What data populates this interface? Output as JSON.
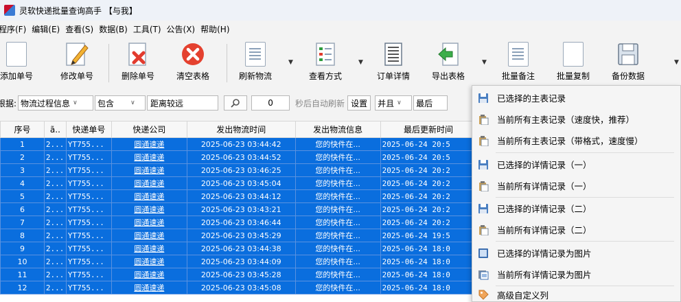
{
  "window": {
    "title": "灵软快递批量查询高手 【与我】"
  },
  "menu": [
    "程序(F)",
    "编辑(E)",
    "查看(S)",
    "数据(B)",
    "工具(T)",
    "公告(X)",
    "帮助(H)"
  ],
  "toolbar": {
    "add": "添加单号",
    "edit": "修改单号",
    "delete": "删除单号",
    "clear": "清空表格",
    "refresh": "刷新物流",
    "view": "查看方式",
    "detail": "订单详情",
    "export": "导出表格",
    "note": "批量备注",
    "copy": "批量复制",
    "backup": "备份数据"
  },
  "filter": {
    "label": "根据:",
    "field": "物流过程信息",
    "op": "包含",
    "value": "距离较远",
    "count": "0",
    "auto_text": "秒后自动刷新",
    "settings": "设置",
    "logic": "并且",
    "field2": "最后"
  },
  "table": {
    "columns": [
      "序号",
      "",
      "快递单号",
      "快递公司",
      "发出物流时间",
      "发出物流信息",
      "最后更新时间"
    ],
    "rows": [
      [
        "1",
        "2...",
        "YT755...",
        "圆通速递",
        "2025-06-23 03:44:42",
        "您的快件在...",
        "2025-06-24 20:5"
      ],
      [
        "2",
        "2...",
        "YT755...",
        "圆通速递",
        "2025-06-23 03:44:52",
        "您的快件在...",
        "2025-06-24 20:5"
      ],
      [
        "3",
        "2...",
        "YT755...",
        "圆通速递",
        "2025-06-23 03:46:25",
        "您的快件在...",
        "2025-06-24 20:2"
      ],
      [
        "4",
        "2...",
        "YT755...",
        "圆通速递",
        "2025-06-23 03:45:04",
        "您的快件在...",
        "2025-06-24 20:2"
      ],
      [
        "5",
        "2...",
        "YT755...",
        "圆通速递",
        "2025-06-23 03:44:12",
        "您的快件在...",
        "2025-06-24 20:2"
      ],
      [
        "6",
        "2...",
        "YT755...",
        "圆通速递",
        "2025-06-23 03:43:21",
        "您的快件在...",
        "2025-06-24 20:2"
      ],
      [
        "7",
        "2...",
        "YT755...",
        "圆通速递",
        "2025-06-23 03:46:44",
        "您的快件在...",
        "2025-06-24 20:2"
      ],
      [
        "8",
        "2...",
        "YT755...",
        "圆通速递",
        "2025-06-23 03:45:29",
        "您的快件在...",
        "2025-06-24 19:5"
      ],
      [
        "9",
        "2...",
        "YT755...",
        "圆通速递",
        "2025-06-23 03:44:38",
        "您的快件在...",
        "2025-06-24 18:0"
      ],
      [
        "10",
        "2...",
        "YT755...",
        "圆通速递",
        "2025-06-23 03:44:09",
        "您的快件在...",
        "2025-06-24 18:0"
      ],
      [
        "11",
        "2...",
        "YT755...",
        "圆通速递",
        "2025-06-23 03:45:28",
        "您的快件在...",
        "2025-06-24 18:0"
      ],
      [
        "12",
        "2...",
        "YT755...",
        "圆通速递",
        "2025-06-23 03:45:08",
        "您的快件在...",
        "2025-06-24 18:0"
      ]
    ]
  },
  "export_menu": [
    {
      "label": "已选择的主表记录",
      "icon": "save-icon"
    },
    {
      "label": "当前所有主表记录（速度快，推荐）",
      "icon": "clipboard-icon"
    },
    {
      "label": "当前所有主表记录（带格式，速度慢）",
      "icon": "clipboard-icon"
    },
    {
      "label": "已选择的详情记录（一）",
      "icon": "save-icon"
    },
    {
      "label": "当前所有详情记录（一）",
      "icon": "clipboard-icon"
    },
    {
      "label": "已选择的详情记录（二）",
      "icon": "save-icon"
    },
    {
      "label": "当前所有详情记录（二）",
      "icon": "clipboard-icon"
    },
    {
      "label": "已选择的详情记录为图片",
      "icon": "image-save-icon"
    },
    {
      "label": "当前所有详情记录为图片",
      "icon": "image-copy-icon"
    },
    {
      "label": "高级自定义列",
      "icon": "tag-icon"
    }
  ],
  "colors": {
    "selection": "#0a6ede",
    "delete_red": "#e23b2e"
  }
}
